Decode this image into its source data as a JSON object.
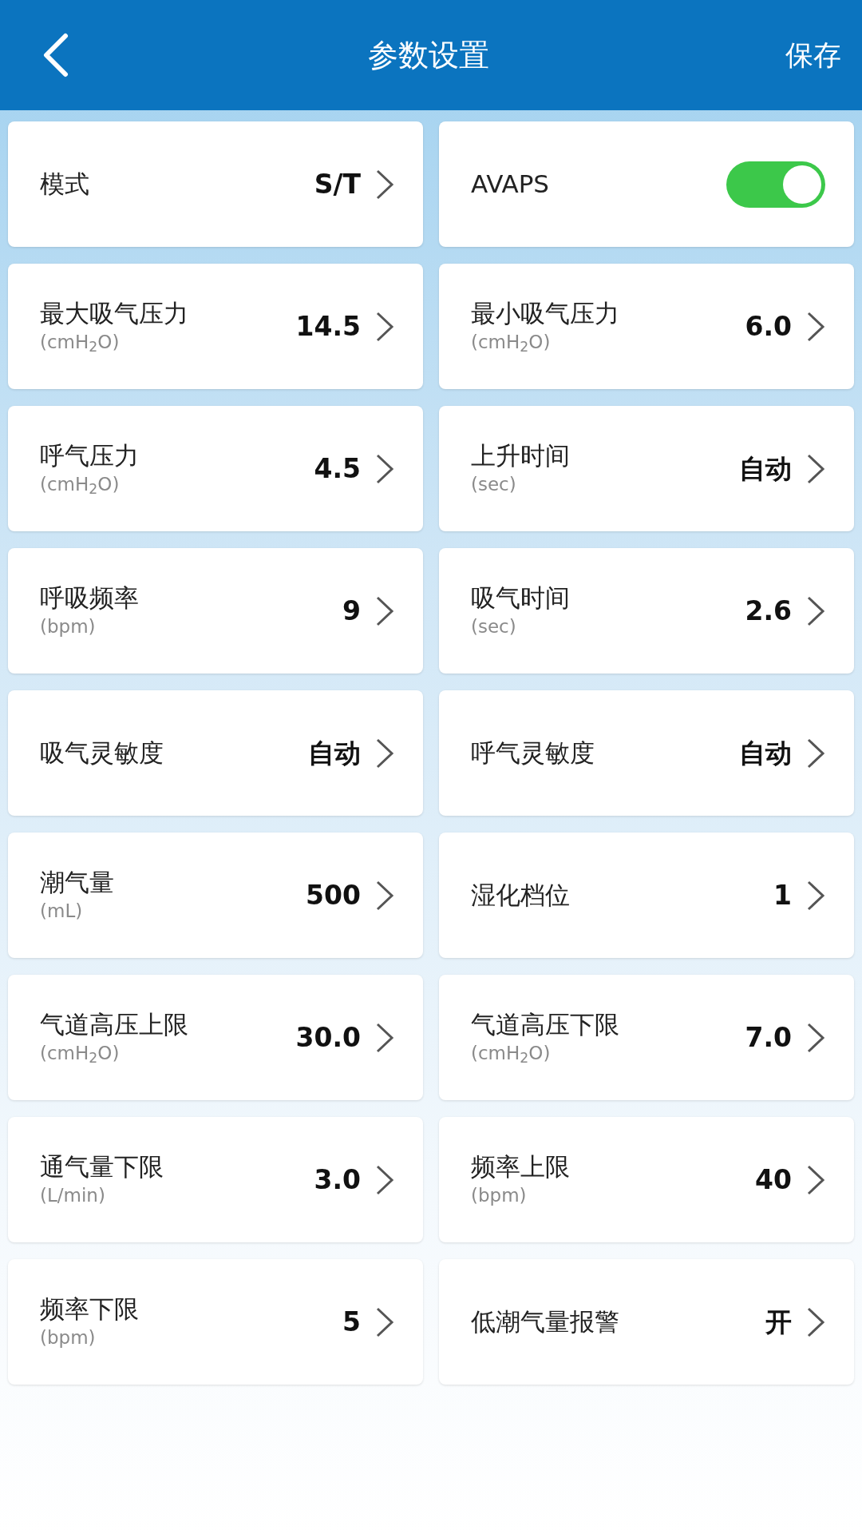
{
  "header": {
    "title": "参数设置",
    "action": "保存"
  },
  "items": [
    {
      "kind": "value",
      "label": "模式",
      "value": "S/T"
    },
    {
      "kind": "toggle",
      "label": "AVAPS",
      "on": true
    },
    {
      "kind": "value",
      "label": "最大吸气压力",
      "unit": "(cmH$_{2}$O)",
      "value": "14.5"
    },
    {
      "kind": "value",
      "label": "最小吸气压力",
      "unit": "(cmH$_{2}$O)",
      "value": "6.0"
    },
    {
      "kind": "value",
      "label": "呼气压力",
      "unit": "(cmH$_{2}$O)",
      "value": "4.5"
    },
    {
      "kind": "value",
      "label": "上升时间",
      "unit": "(sec)",
      "value": "自动"
    },
    {
      "kind": "value",
      "label": "呼吸频率",
      "unit": "(bpm)",
      "value": "9"
    },
    {
      "kind": "value",
      "label": "吸气时间",
      "unit": "(sec)",
      "value": "2.6"
    },
    {
      "kind": "value",
      "label": "吸气灵敏度",
      "value": "自动"
    },
    {
      "kind": "value",
      "label": "呼气灵敏度",
      "value": "自动"
    },
    {
      "kind": "value",
      "label": "潮气量",
      "unit": "(mL)",
      "value": "500"
    },
    {
      "kind": "value",
      "label": "湿化档位",
      "value": "1"
    },
    {
      "kind": "value",
      "label": "气道高压上限",
      "unit": "(cmH$_{2}$O)",
      "value": "30.0"
    },
    {
      "kind": "value",
      "label": "气道高压下限",
      "unit": "(cmH$_{2}$O)",
      "value": "7.0"
    },
    {
      "kind": "value",
      "label": "通气量下限",
      "unit": "(L/min)",
      "value": "3.0"
    },
    {
      "kind": "value",
      "label": "频率上限",
      "unit": "(bpm)",
      "value": "40"
    },
    {
      "kind": "value",
      "label": "频率下限",
      "unit": "(bpm)",
      "value": "5"
    },
    {
      "kind": "value",
      "label": "低潮气量报警",
      "value": "开"
    }
  ]
}
